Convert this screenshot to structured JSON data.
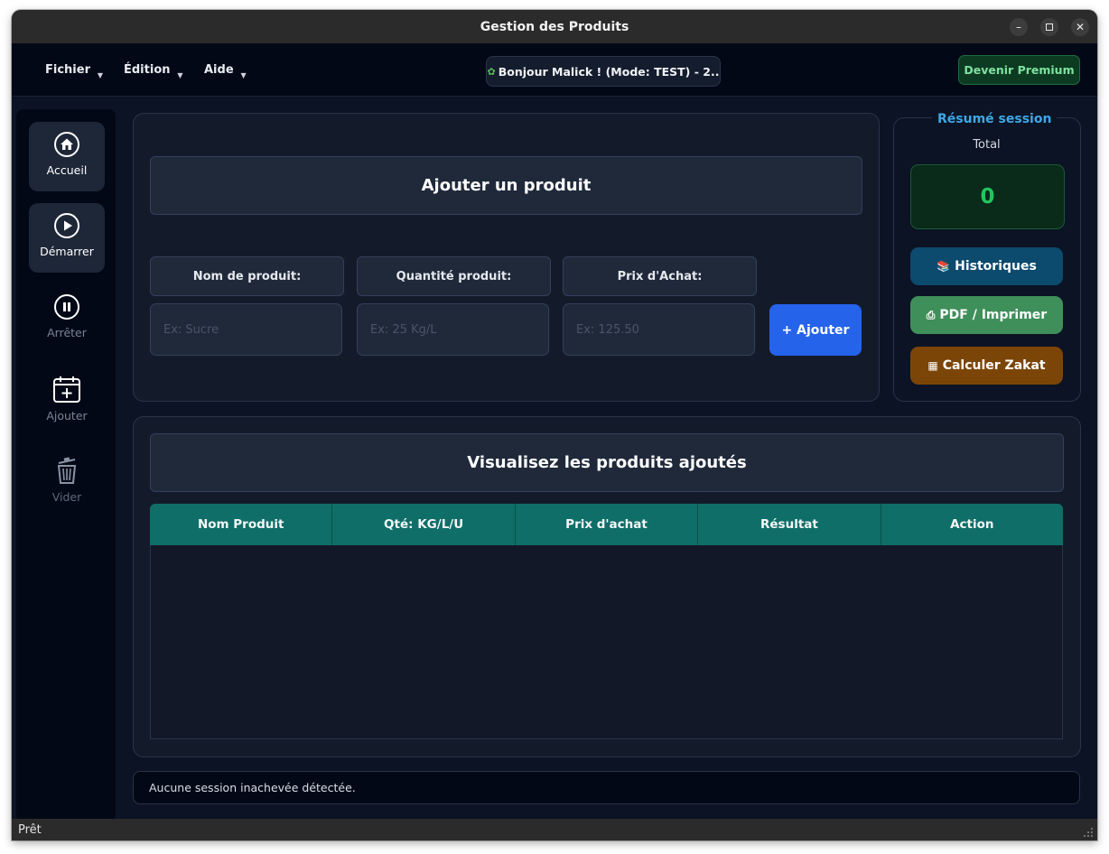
{
  "window": {
    "title": "Gestion des Produits"
  },
  "menubar": {
    "items": [
      {
        "label": "Fichier"
      },
      {
        "label": "Édition"
      },
      {
        "label": "Aide"
      }
    ],
    "greeting": "Bonjour Malick ! (Mode: TEST) - 2..",
    "premium_label": "Devenir Premium"
  },
  "sidebar": {
    "items": [
      {
        "label": "Accueil",
        "icon": "home-icon",
        "active": true
      },
      {
        "label": "Démarrer",
        "icon": "play-icon",
        "active": true
      },
      {
        "label": "Arrêter",
        "icon": "pause-icon",
        "active": false
      },
      {
        "label": "Ajouter",
        "icon": "calendar-plus-icon",
        "active": false
      },
      {
        "label": "Vider",
        "icon": "trash-icon",
        "active": false
      }
    ]
  },
  "form": {
    "title": "Ajouter un produit",
    "fields": [
      {
        "label": "Nom de produit:",
        "placeholder": "Ex: Sucre",
        "value": ""
      },
      {
        "label": "Quantité produit:",
        "placeholder": "Ex: 25 Kg/L",
        "value": ""
      },
      {
        "label": "Prix d'Achat:",
        "placeholder": "Ex: 125.50",
        "value": ""
      }
    ],
    "add_button": "+ Ajouter"
  },
  "summary": {
    "title": "Résumé session",
    "total_label": "Total",
    "total_value": "0",
    "buttons": [
      {
        "label": "Historiques",
        "icon": "books-icon",
        "color": "#0c4a6e"
      },
      {
        "label": "PDF / Imprimer",
        "icon": "printer-icon",
        "color": "#3f8f5a"
      },
      {
        "label": "Calculer Zakat",
        "icon": "abacus-icon",
        "color": "#7c4508"
      }
    ]
  },
  "products": {
    "title": "Visualisez les produits ajoutés",
    "columns": [
      "Nom Produit",
      "Qté: KG/L/U",
      "Prix d'achat",
      "Résultat",
      "Action"
    ],
    "rows": []
  },
  "status": {
    "message": "Aucune session inachevée détectée.",
    "bar_text": "Prêt"
  },
  "colors": {
    "accent_blue": "#2563eb",
    "table_header": "#0f6e68",
    "total_green": "#22c55e",
    "summary_title": "#3ea8e6"
  }
}
